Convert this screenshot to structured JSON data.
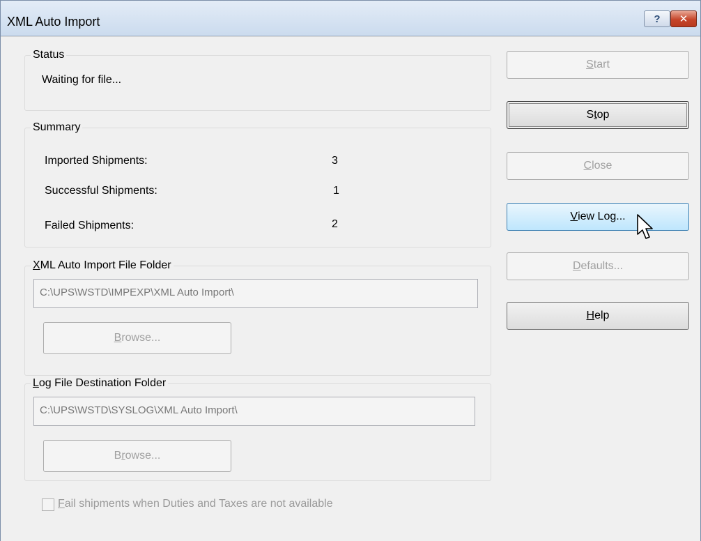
{
  "window": {
    "title": "XML Auto Import"
  },
  "status": {
    "legend": "Status",
    "message": "Waiting for file..."
  },
  "summary": {
    "legend": "Summary",
    "rows": [
      {
        "label": "Imported Shipments:",
        "value": "3"
      },
      {
        "label": "Successful Shipments:",
        "value": "1"
      },
      {
        "label": "Failed Shipments:",
        "value": "2"
      }
    ]
  },
  "xml_folder": {
    "legend_pre": "",
    "legend_key": "X",
    "legend_post": "ML Auto Import File Folder",
    "path": "C:\\UPS\\WSTD\\IMPEXP\\XML Auto Import\\",
    "browse_pre": "",
    "browse_key": "B",
    "browse_post": "rowse..."
  },
  "log_folder": {
    "legend_pre": "",
    "legend_key": "L",
    "legend_post": "og File Destination Folder",
    "path": "C:\\UPS\\WSTD\\SYSLOG\\XML Auto Import\\",
    "browse_pre": "B",
    "browse_key": "r",
    "browse_post": "owse..."
  },
  "checkbox": {
    "pre": "",
    "key": "F",
    "post": "ail shipments when Duties and Taxes are not available",
    "checked": false
  },
  "buttons": {
    "start": {
      "pre": "",
      "key": "S",
      "post": "tart"
    },
    "stop": {
      "pre": "S",
      "key": "t",
      "post": "op"
    },
    "close": {
      "pre": "",
      "key": "C",
      "post": "lose"
    },
    "view_log": {
      "pre": "",
      "key": "V",
      "post": "iew Log..."
    },
    "defaults": {
      "pre": "",
      "key": "D",
      "post": "efaults..."
    },
    "help": {
      "pre": "",
      "key": "H",
      "post": "elp"
    }
  },
  "icons": {
    "help": "?",
    "close": "✕",
    "cursor": "arrow-pointer-icon"
  },
  "colors": {
    "hover_button": "#bee6fd",
    "close_button": "#c6452a",
    "disabled_text": "#a0a0a0"
  }
}
